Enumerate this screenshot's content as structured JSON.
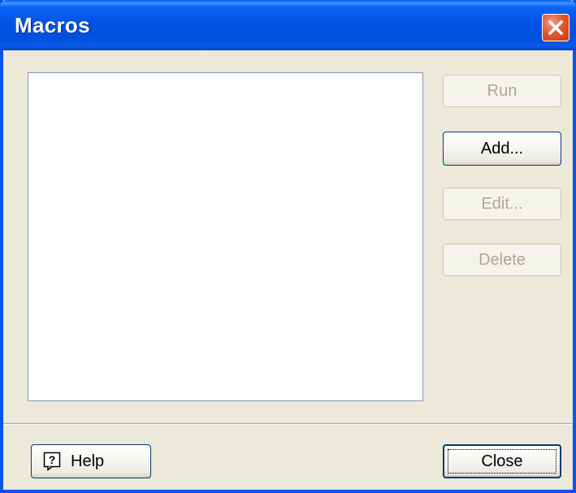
{
  "window": {
    "title": "Macros"
  },
  "buttons": {
    "run": "Run",
    "add": "Add...",
    "edit": "Edit...",
    "delete": "Delete",
    "help": "Help",
    "close": "Close"
  },
  "macro_list": {
    "items": []
  },
  "icons": {
    "close": "close-icon",
    "help": "help-icon"
  },
  "colors": {
    "titlebar": "#0054e3",
    "dialog_bg": "#ece9d8",
    "close_button": "#e25a30",
    "disabled_text": "#aca899"
  }
}
